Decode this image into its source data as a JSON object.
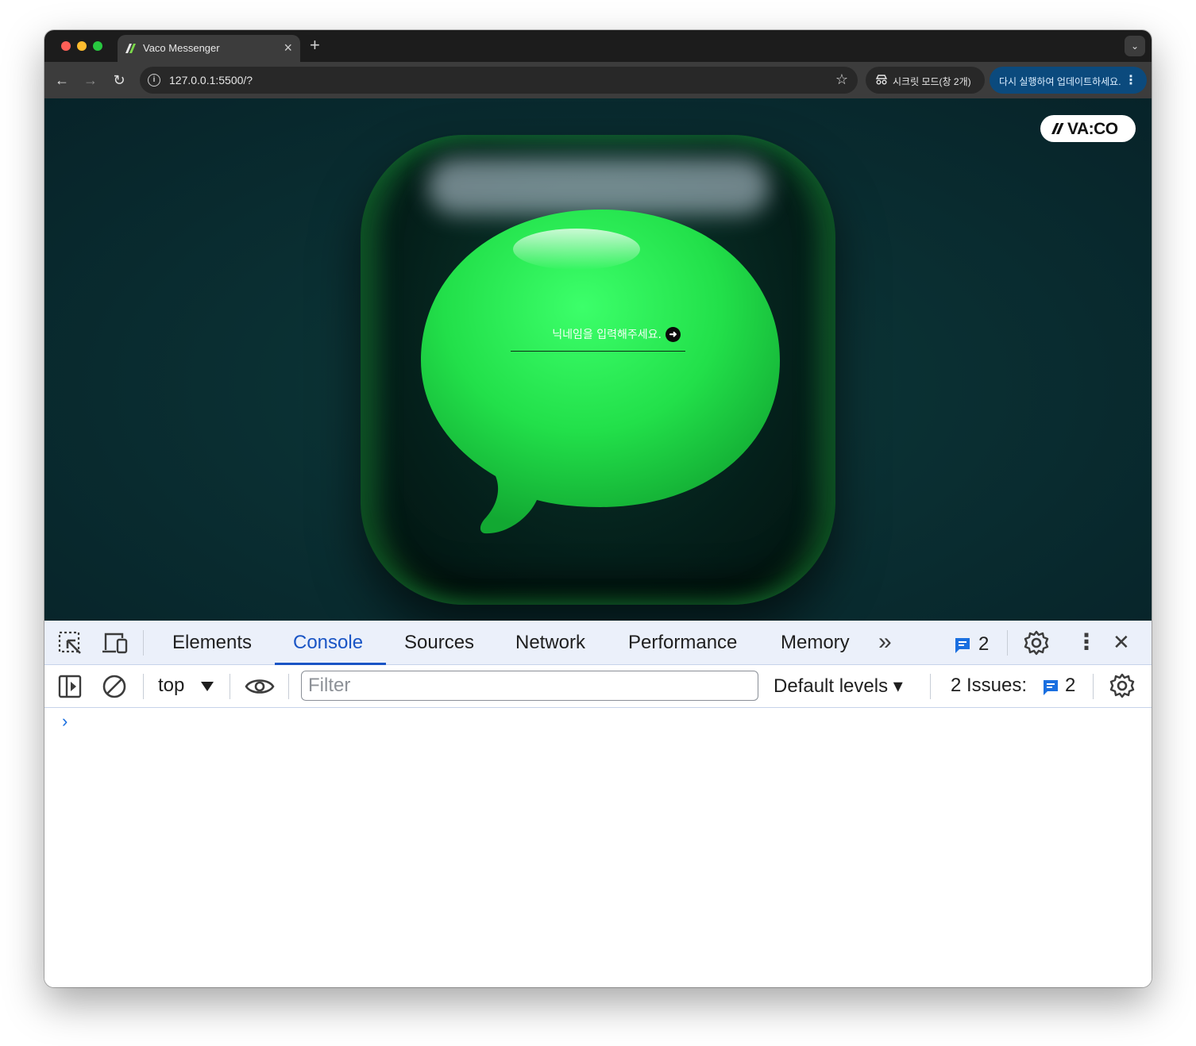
{
  "browser": {
    "tab_title": "Vaco Messenger",
    "tab_close": "×",
    "new_tab": "+",
    "tab_search": "⌄",
    "url": "127.0.0.1:5500/?",
    "incognito_label": "시크릿 모드(창 2개)",
    "update_label": "다시 실행하여 업데이트하세요.",
    "update_menu": "⋮",
    "back": "←",
    "forward": "→",
    "reload": "↻",
    "star": "☆",
    "info": "i"
  },
  "page": {
    "logo_text": "VA:CO",
    "nickname_placeholder": "닉네임을 입력해주세요.",
    "submit_glyph": "➜",
    "colors": {
      "background": "#0a2f32",
      "bubble": "#22e04a",
      "logo_bg": "#ffffff"
    }
  },
  "devtools": {
    "tabs": [
      "Elements",
      "Console",
      "Sources",
      "Network",
      "Performance",
      "Memory"
    ],
    "active_tab": "Console",
    "more_tabs": "»",
    "message_count": "2",
    "context": "top",
    "filter_placeholder": "Filter",
    "levels": "Default levels ▾",
    "issues_label": "2 Issues:",
    "issues_count": "2",
    "prompt": "›",
    "close": "✕",
    "menu": "⋮",
    "accent": "#1a55c5"
  }
}
